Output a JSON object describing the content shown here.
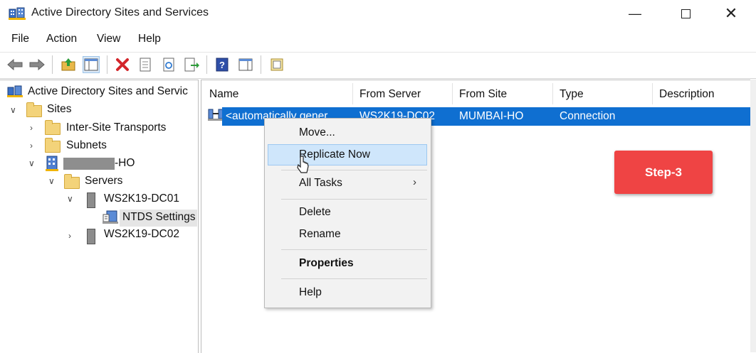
{
  "window": {
    "title": "Active Directory Sites and Services",
    "minimize_icon": "minimize-icon",
    "maximize_icon": "maximize-icon",
    "close_icon": "close-icon"
  },
  "menu": [
    "File",
    "Action",
    "View",
    "Help"
  ],
  "toolbar": {
    "icons": [
      "back-arrow-icon",
      "forward-arrow-icon",
      "up-folder-icon",
      "show-hide-console-tree-icon",
      "delete-icon",
      "properties-icon",
      "refresh-icon",
      "export-list-icon",
      "help-icon",
      "show-action-pane-icon",
      "new-window-icon"
    ]
  },
  "tree": {
    "root": "Active Directory Sites and Servic",
    "sites": "Sites",
    "inter_site": "Inter-Site Transports",
    "subnets": "Subnets",
    "site_name_suffix": "-HO",
    "servers": "Servers",
    "dc01": "WS2K19-DC01",
    "ntds": "NTDS Settings",
    "dc02": "WS2K19-DC02"
  },
  "list": {
    "columns": [
      "Name",
      "From Server",
      "From Site",
      "Type",
      "Description"
    ],
    "rows": [
      {
        "name": "<automatically gener",
        "from_server": "WS2K19-DC02",
        "from_site": "MUMBAI-HO",
        "type": "Connection",
        "description": ""
      }
    ]
  },
  "context_menu": {
    "items": [
      "Move...",
      "Replicate Now",
      "All Tasks",
      "Delete",
      "Rename",
      "Properties",
      "Help"
    ],
    "highlighted": "Replicate Now"
  },
  "annotation": {
    "step_label": "Step-3",
    "color": "#ef4444"
  },
  "colors": {
    "selection": "#0f6fd1",
    "menu_highlight": "#cfe6fb"
  }
}
